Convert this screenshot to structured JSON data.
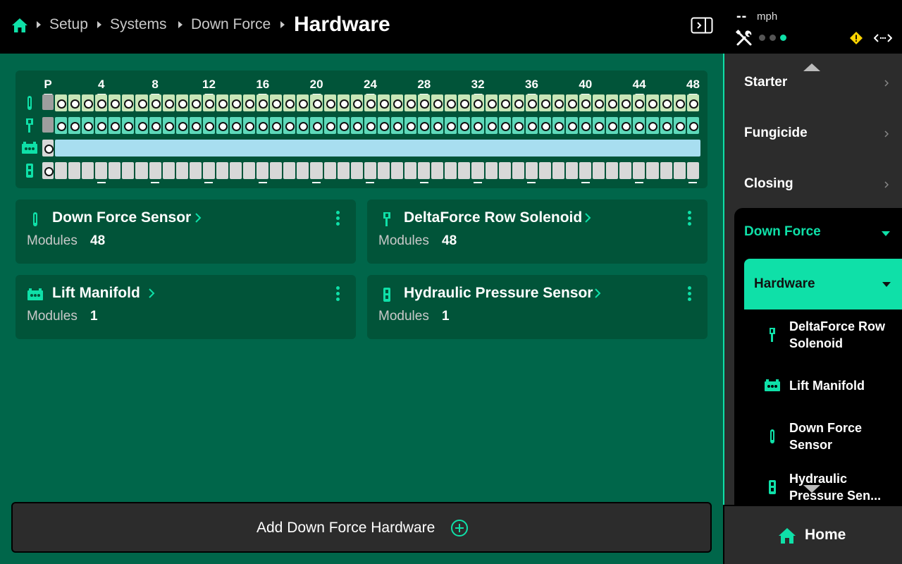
{
  "breadcrumb": {
    "items": [
      "Setup",
      "Systems",
      "Down Force"
    ],
    "current": "Hardware"
  },
  "status": {
    "speed_value": "--",
    "speed_unit": "mph",
    "connection_dots": [
      "#555555",
      "#555555",
      "#0fe0a8"
    ]
  },
  "row_map": {
    "row_labels": [
      "P",
      "4",
      "8",
      "12",
      "16",
      "20",
      "24",
      "28",
      "32",
      "36",
      "40",
      "44",
      "48"
    ],
    "row_count": 48,
    "lanes": [
      {
        "icon": "down-force-sensor-icon",
        "style": "green"
      },
      {
        "icon": "solenoid-icon",
        "style": "teal"
      },
      {
        "icon": "lift-manifold-icon",
        "style": "blue"
      },
      {
        "icon": "pressure-sensor-icon",
        "style": "gray"
      }
    ]
  },
  "cards": [
    {
      "title": "Down Force Sensor",
      "modules_label": "Modules",
      "modules_value": "48",
      "icon": "down-force-sensor-icon"
    },
    {
      "title": "DeltaForce Row Solenoid",
      "modules_label": "Modules",
      "modules_value": "48",
      "icon": "solenoid-icon"
    },
    {
      "title": "Lift Manifold",
      "modules_label": "Modules",
      "modules_value": "1",
      "icon": "lift-manifold-icon"
    },
    {
      "title": "Hydraulic Pressure Sensor",
      "modules_label": "Modules",
      "modules_value": "1",
      "icon": "pressure-sensor-icon"
    }
  ],
  "add_button": {
    "label": "Add Down Force Hardware"
  },
  "sidebar": {
    "items": [
      {
        "label": "Starter"
      },
      {
        "label": "Fungicide"
      },
      {
        "label": "Closing"
      }
    ],
    "active_group": "Down Force",
    "active_section": "Hardware",
    "sub_items": [
      {
        "label": "DeltaForce Row Solenoid",
        "icon": "solenoid-icon"
      },
      {
        "label": "Lift Manifold",
        "icon": "lift-manifold-icon"
      },
      {
        "label": "Down Force Sensor",
        "icon": "down-force-sensor-icon"
      },
      {
        "label": "Hydraulic Pressure Sen...",
        "icon": "pressure-sensor-icon"
      }
    ]
  },
  "home_button": {
    "label": "Home"
  },
  "colors": {
    "accent": "#0fe0a8",
    "main_bg": "#00664a",
    "card_bg": "#015439",
    "sidebar_bg": "#2c2c2c"
  }
}
